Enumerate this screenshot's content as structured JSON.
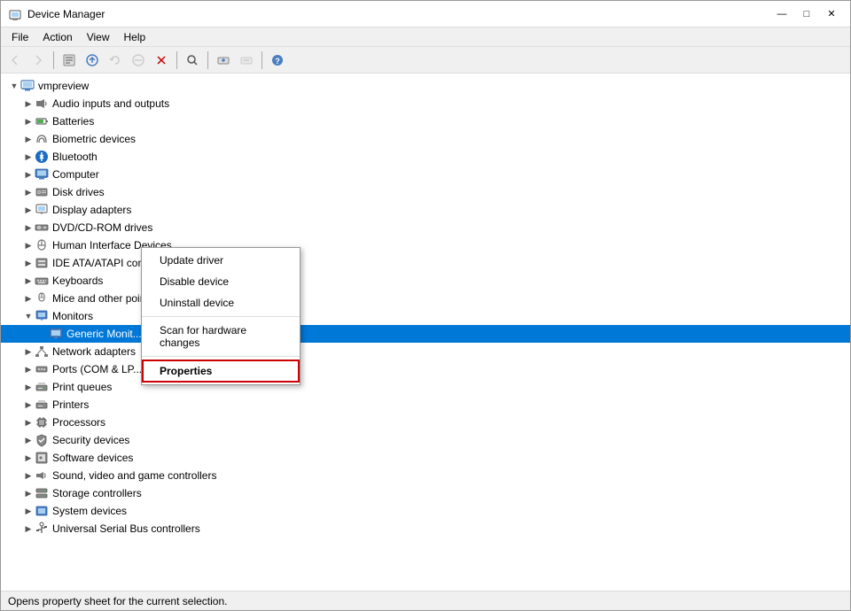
{
  "window": {
    "title": "Device Manager",
    "icon": "⚙"
  },
  "titlebar_buttons": {
    "minimize": "—",
    "maximize": "□",
    "close": "✕"
  },
  "menu": {
    "items": [
      "File",
      "Action",
      "View",
      "Help"
    ]
  },
  "toolbar": {
    "buttons": [
      {
        "name": "back",
        "icon": "◀",
        "disabled": true
      },
      {
        "name": "forward",
        "icon": "▶",
        "disabled": true
      },
      {
        "name": "properties",
        "icon": "📋",
        "disabled": false
      },
      {
        "name": "update",
        "icon": "🔄",
        "disabled": false
      },
      {
        "name": "rollback",
        "icon": "↩",
        "disabled": true
      },
      {
        "name": "disable",
        "icon": "🚫",
        "disabled": true
      },
      {
        "name": "uninstall",
        "icon": "✖",
        "disabled": false
      },
      {
        "name": "scan",
        "icon": "🔍",
        "disabled": false
      },
      {
        "name": "add",
        "icon": "+",
        "disabled": false
      },
      {
        "name": "remove",
        "icon": "✖",
        "disabled": true
      },
      {
        "name": "info",
        "icon": "ℹ",
        "disabled": false
      }
    ]
  },
  "tree": {
    "root": "vmpreview",
    "items": [
      {
        "id": "audio",
        "label": "Audio inputs and outputs",
        "level": 2,
        "expanded": false,
        "icon": "audio"
      },
      {
        "id": "batteries",
        "label": "Batteries",
        "level": 2,
        "expanded": false,
        "icon": "battery"
      },
      {
        "id": "biometric",
        "label": "Biometric devices",
        "level": 2,
        "expanded": false,
        "icon": "security"
      },
      {
        "id": "bluetooth",
        "label": "Bluetooth",
        "level": 2,
        "expanded": false,
        "icon": "bluetooth"
      },
      {
        "id": "computer",
        "label": "Computer",
        "level": 2,
        "expanded": false,
        "icon": "computer"
      },
      {
        "id": "disk",
        "label": "Disk drives",
        "level": 2,
        "expanded": false,
        "icon": "disk"
      },
      {
        "id": "display",
        "label": "Display adapters",
        "level": 2,
        "expanded": false,
        "icon": "display"
      },
      {
        "id": "dvd",
        "label": "DVD/CD-ROM drives",
        "level": 2,
        "expanded": false,
        "icon": "dvd"
      },
      {
        "id": "hid",
        "label": "Human Interface Devices",
        "level": 2,
        "expanded": false,
        "icon": "hid"
      },
      {
        "id": "ide",
        "label": "IDE ATA/ATAPI controllers",
        "level": 2,
        "expanded": false,
        "icon": "ide"
      },
      {
        "id": "keyboards",
        "label": "Keyboards",
        "level": 2,
        "expanded": false,
        "icon": "keyboard"
      },
      {
        "id": "mice",
        "label": "Mice and other pointing devices",
        "level": 2,
        "expanded": false,
        "icon": "mouse"
      },
      {
        "id": "monitors",
        "label": "Monitors",
        "level": 2,
        "expanded": true,
        "icon": "monitor"
      },
      {
        "id": "generic_monitor",
        "label": "Generic Monit...",
        "level": 3,
        "expanded": false,
        "icon": "monitor",
        "selected": true
      },
      {
        "id": "network",
        "label": "Network adapters",
        "level": 2,
        "expanded": false,
        "icon": "network"
      },
      {
        "id": "ports",
        "label": "Ports (COM & LP...",
        "level": 2,
        "expanded": false,
        "icon": "ports"
      },
      {
        "id": "print_queues",
        "label": "Print queues",
        "level": 2,
        "expanded": false,
        "icon": "print"
      },
      {
        "id": "printers",
        "label": "Printers",
        "level": 2,
        "expanded": false,
        "icon": "printer"
      },
      {
        "id": "processors",
        "label": "Processors",
        "level": 2,
        "expanded": false,
        "icon": "processor"
      },
      {
        "id": "security",
        "label": "Security devices",
        "level": 2,
        "expanded": false,
        "icon": "security"
      },
      {
        "id": "software",
        "label": "Software devices",
        "level": 2,
        "expanded": false,
        "icon": "software"
      },
      {
        "id": "sound",
        "label": "Sound, video and game controllers",
        "level": 2,
        "expanded": false,
        "icon": "sound"
      },
      {
        "id": "storage",
        "label": "Storage controllers",
        "level": 2,
        "expanded": false,
        "icon": "storage"
      },
      {
        "id": "system",
        "label": "System devices",
        "level": 2,
        "expanded": false,
        "icon": "system"
      },
      {
        "id": "usb",
        "label": "Universal Serial Bus controllers",
        "level": 2,
        "expanded": false,
        "icon": "usb"
      }
    ]
  },
  "context_menu": {
    "items": [
      {
        "label": "Update driver",
        "id": "update"
      },
      {
        "label": "Disable device",
        "id": "disable"
      },
      {
        "label": "Uninstall device",
        "id": "uninstall"
      },
      {
        "separator": true
      },
      {
        "label": "Scan for hardware changes",
        "id": "scan"
      },
      {
        "separator": false
      },
      {
        "label": "Properties",
        "id": "properties",
        "highlighted": true
      }
    ]
  },
  "status_bar": {
    "text": "Opens property sheet for the current selection."
  }
}
